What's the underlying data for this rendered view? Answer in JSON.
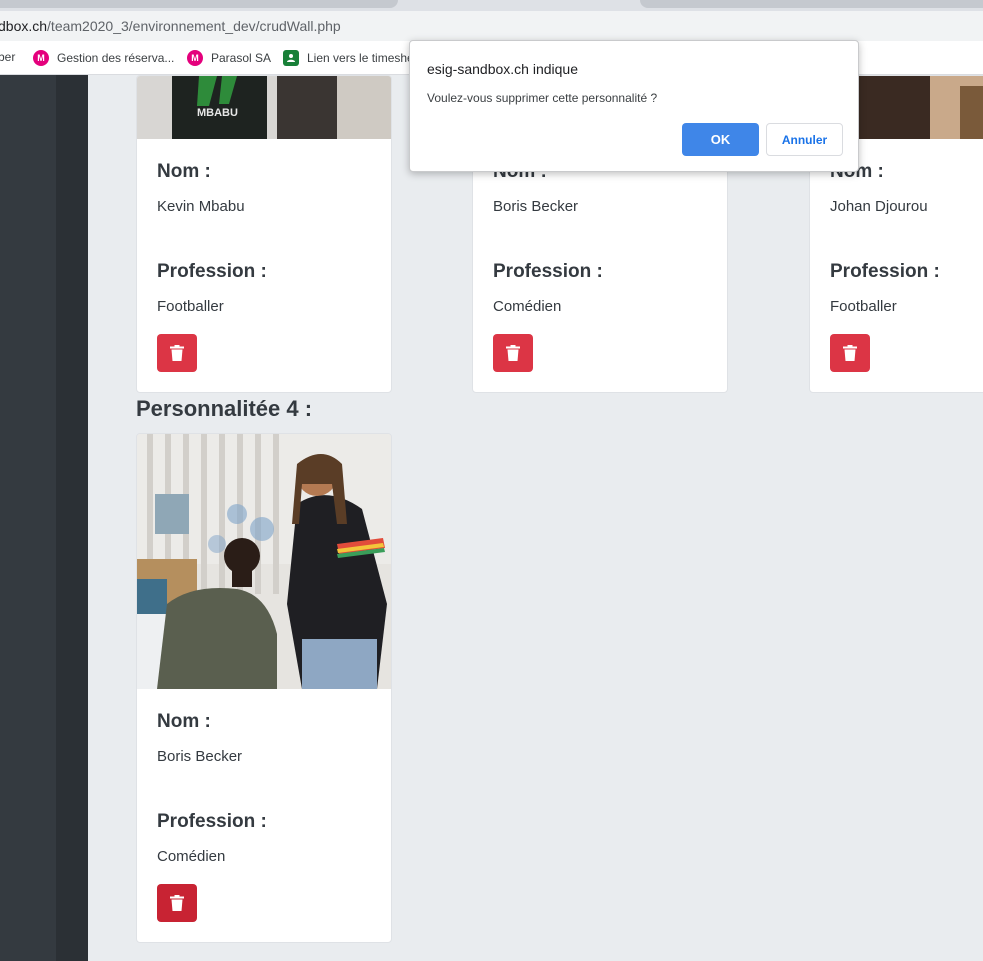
{
  "browser": {
    "url_host": "dbox.ch",
    "url_path": "/team2020_3/environnement_dev/crudWall.php",
    "bookmarks": [
      {
        "label": "ber",
        "icon": "none"
      },
      {
        "label": "Gestion des réserva...",
        "icon": "m-logo-icon"
      },
      {
        "label": "Parasol SA",
        "icon": "m-logo-icon"
      },
      {
        "label": "Lien vers le timeshe",
        "icon": "person-icon"
      }
    ]
  },
  "cards": [
    {
      "nom_label": "Nom :",
      "nom": "Kevin Mbabu",
      "profession_label": "Profession :",
      "profession": "Footballer"
    },
    {
      "nom_label": "Nom :",
      "nom": "Boris Becker",
      "profession_label": "Profession :",
      "profession": "Comédien"
    },
    {
      "nom_label": "Nom :",
      "nom": "Johan Djourou",
      "profession_label": "Profession :",
      "profession": "Footballer"
    },
    {
      "nom_label": "Nom :",
      "nom": "Boris Becker",
      "profession_label": "Profession :",
      "profession": "Comédien"
    }
  ],
  "section": {
    "title": "Personnalitée 4 :"
  },
  "dialog": {
    "title": "esig-sandbox.ch indique",
    "message": "Voulez-vous supprimer cette personnalité ?",
    "ok_label": "OK",
    "cancel_label": "Annuler"
  },
  "colors": {
    "danger": "#dc3545",
    "ok_button": "#3f86e8",
    "sidebar": "#343a40"
  }
}
